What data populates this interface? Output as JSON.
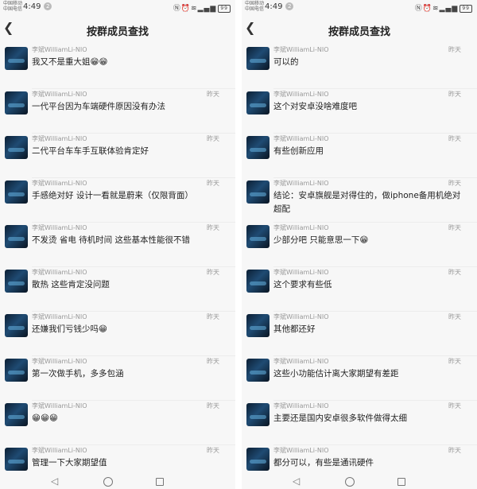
{
  "left": {
    "status": {
      "carrier_top": "中国移动",
      "carrier_bottom": "中国电信",
      "time": "4:49",
      "notif_count": "2",
      "battery": "99"
    },
    "title": "按群成员查找",
    "messages": [
      {
        "name": "李斌WilliamLi-NIO",
        "time": "",
        "text": "我又不是重大姐😁😁"
      },
      {
        "name": "李斌WilliamLi-NIO",
        "time": "昨天",
        "text": "一代平台因为车端硬件原因没有办法"
      },
      {
        "name": "李斌WilliamLi-NIO",
        "time": "昨天",
        "text": "二代平台车车手互联体验肯定好"
      },
      {
        "name": "李斌WilliamLi-NIO",
        "time": "昨天",
        "text": "手感绝对好 设计一看就是蔚来（仅限背面）"
      },
      {
        "name": "李斌WilliamLi-NIO",
        "time": "昨天",
        "text": "不发烫 省电 待机时间 这些基本性能很不错"
      },
      {
        "name": "李斌WilliamLi-NIO",
        "time": "昨天",
        "text": "散热 这些肯定没问题"
      },
      {
        "name": "李斌WilliamLi-NIO",
        "time": "昨天",
        "text": "还嫌我们亏钱少吗😁"
      },
      {
        "name": "李斌WilliamLi-NIO",
        "time": "昨天",
        "text": "第一次做手机，多多包涵"
      },
      {
        "name": "李斌WilliamLi-NIO",
        "time": "昨天",
        "text": "😁😁😁"
      },
      {
        "name": "李斌WilliamLi-NIO",
        "time": "昨天",
        "text": "管理一下大家期望值"
      }
    ]
  },
  "right": {
    "status": {
      "carrier_top": "中国移动",
      "carrier_bottom": "中国电信",
      "time": "4:49",
      "notif_count": "2",
      "battery": "99"
    },
    "title": "按群成员查找",
    "messages": [
      {
        "name": "李斌WilliamLi-NIO",
        "time": "昨天",
        "text": "可以的"
      },
      {
        "name": "李斌WilliamLi-NIO",
        "time": "昨天",
        "text": "这个对安卓没啥难度吧"
      },
      {
        "name": "李斌WilliamLi-NIO",
        "time": "昨天",
        "text": "有些创新应用"
      },
      {
        "name": "李斌WilliamLi-NIO",
        "time": "昨天",
        "text": "结论：安卓旗舰是对得住的，做iphone备用机绝对超配"
      },
      {
        "name": "李斌WilliamLi-NIO",
        "time": "昨天",
        "text": "少部分吧 只能意思一下😁"
      },
      {
        "name": "李斌WilliamLi-NIO",
        "time": "昨天",
        "text": "这个要求有些低"
      },
      {
        "name": "李斌WilliamLi-NIO",
        "time": "昨天",
        "text": "其他都还好"
      },
      {
        "name": "李斌WilliamLi-NIO",
        "time": "昨天",
        "text": "这些小功能估计离大家期望有差距"
      },
      {
        "name": "李斌WilliamLi-NIO",
        "time": "昨天",
        "text": "主要还是国内安卓很多软件做得太细"
      },
      {
        "name": "李斌WilliamLi-NIO",
        "time": "昨天",
        "text": "都分可以，有些是通讯硬件"
      }
    ]
  },
  "icons": {
    "back": "chevron-left-icon",
    "nav_back": "triangle-back-icon",
    "nav_home": "circle-home-icon",
    "nav_recent": "square-recent-icon"
  }
}
